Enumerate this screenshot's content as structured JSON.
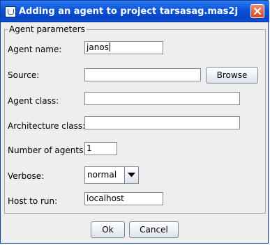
{
  "window": {
    "title": "Adding an agent to project tarsasag.mas2j"
  },
  "group": {
    "title": "Agent parameters"
  },
  "fields": {
    "agent_name": {
      "label": "Agent name:",
      "value": "janos"
    },
    "source": {
      "label": "Source:",
      "value": ""
    },
    "agent_class": {
      "label": "Agent class:",
      "value": ""
    },
    "architecture_class": {
      "label": "Architecture class:",
      "value": ""
    },
    "number_of_agents": {
      "label": "Number of agents:",
      "value": "1"
    },
    "verbose": {
      "label": "Verbose:",
      "value": "normal"
    },
    "host_to_run": {
      "label": "Host to run:",
      "value": "localhost"
    }
  },
  "buttons": {
    "browse": "Browse",
    "ok": "Ok",
    "cancel": "Cancel"
  },
  "icons": {
    "app": "java-cup-icon",
    "close": "close-icon",
    "dropdown": "chevron-down-icon"
  },
  "colors": {
    "titlebar": "#0a52d8",
    "close_button": "#d94423",
    "window_background": "#eeeeee"
  }
}
